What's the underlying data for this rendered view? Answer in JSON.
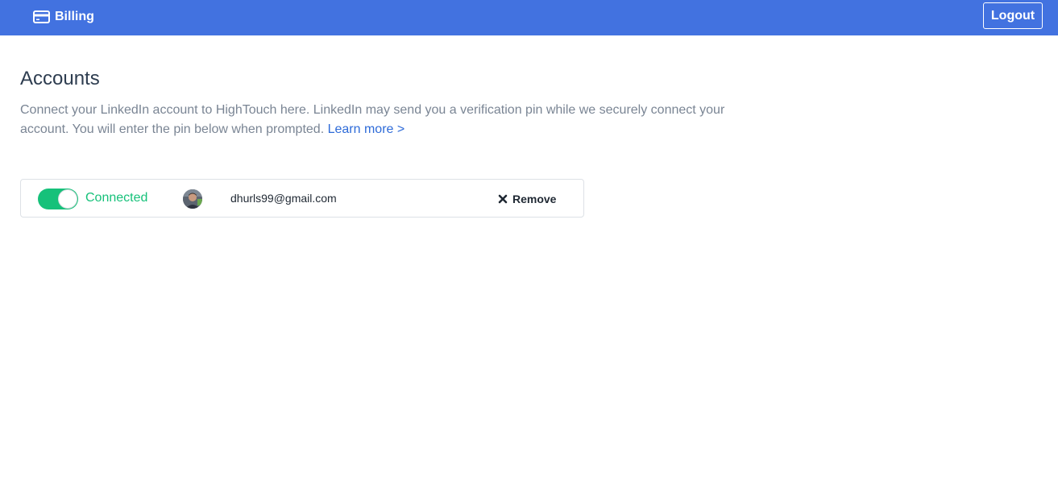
{
  "header": {
    "billing_label": "Billing",
    "billing_icon": "credit-card-icon",
    "logout_label": "Logout",
    "background_color": "#4272e0"
  },
  "main": {
    "title": "Accounts",
    "description": "Connect your LinkedIn account to HighTouch here. LinkedIn may send you a verification pin while we securely connect your account. You will enter the pin below when prompted.",
    "learn_more_label": "Learn more >"
  },
  "accounts": [
    {
      "connected": true,
      "status_label": "Connected",
      "email": "dhurls99@gmail.com",
      "remove_label": "Remove",
      "remove_icon": "close-icon",
      "status_color": "#16c17a"
    }
  ]
}
